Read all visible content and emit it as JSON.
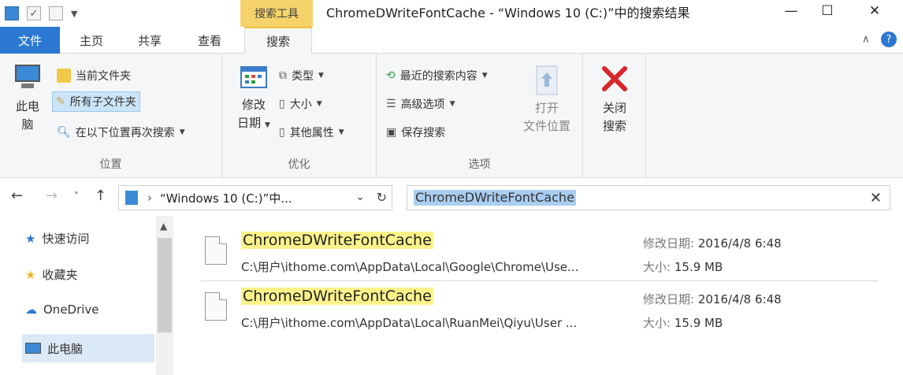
{
  "window": {
    "context_tab": "搜索工具",
    "title": "ChromeDWriteFontCache - “Windows 10 (C:)”中的搜索结果",
    "minimize": "—",
    "maximize": "☐",
    "close": "✕"
  },
  "tabs": {
    "file": "文件",
    "home": "主页",
    "share": "共享",
    "view": "查看",
    "search": "搜索"
  },
  "ribbon": {
    "location": {
      "label": "位置",
      "this_pc_line1": "此电",
      "this_pc_line2": "脑",
      "current_folder": "当前文件夹",
      "all_subfolders": "所有子文件夹",
      "search_again_in": "在以下位置再次搜索"
    },
    "refine": {
      "label": "优化",
      "date_modified_line1": "修改",
      "date_modified_line2": "日期",
      "kind": "类型",
      "size": "大小",
      "other_properties": "其他属性"
    },
    "options": {
      "label": "选项",
      "recent_searches": "最近的搜索内容",
      "advanced_options": "高级选项",
      "save_search": "保存搜索",
      "open_location_line1": "打开",
      "open_location_line2": "文件位置"
    },
    "close_search": {
      "line1": "关闭",
      "line2": "搜索"
    }
  },
  "address": {
    "path": "“Windows 10 (C:)”中...",
    "search_value": "ChromeDWriteFontCache"
  },
  "nav": {
    "items": [
      {
        "label": "快速访问"
      },
      {
        "label": "收藏夹"
      },
      {
        "label": "OneDrive"
      },
      {
        "label": "此电脑"
      }
    ]
  },
  "results": [
    {
      "name": "ChromeDWriteFontCache",
      "path": "C:\\用户\\ithome.com\\AppData\\Local\\Google\\Chrome\\Use...",
      "date_label": "修改日期:",
      "date_value": "2016/4/8 6:48",
      "size_label": "大小:",
      "size_value": "15.9 MB"
    },
    {
      "name": "ChromeDWriteFontCache",
      "path": "C:\\用户\\ithome.com\\AppData\\Local\\RuanMei\\Qiyu\\User ...",
      "date_label": "修改日期:",
      "date_value": "2016/4/8 6:48",
      "size_label": "大小:",
      "size_value": "15.9 MB"
    }
  ],
  "colors": {
    "file_tab": "#2b78d2",
    "context_tab": "#f6d26a",
    "highlight": "#fdf28a",
    "selection": "#a9cdf0"
  }
}
